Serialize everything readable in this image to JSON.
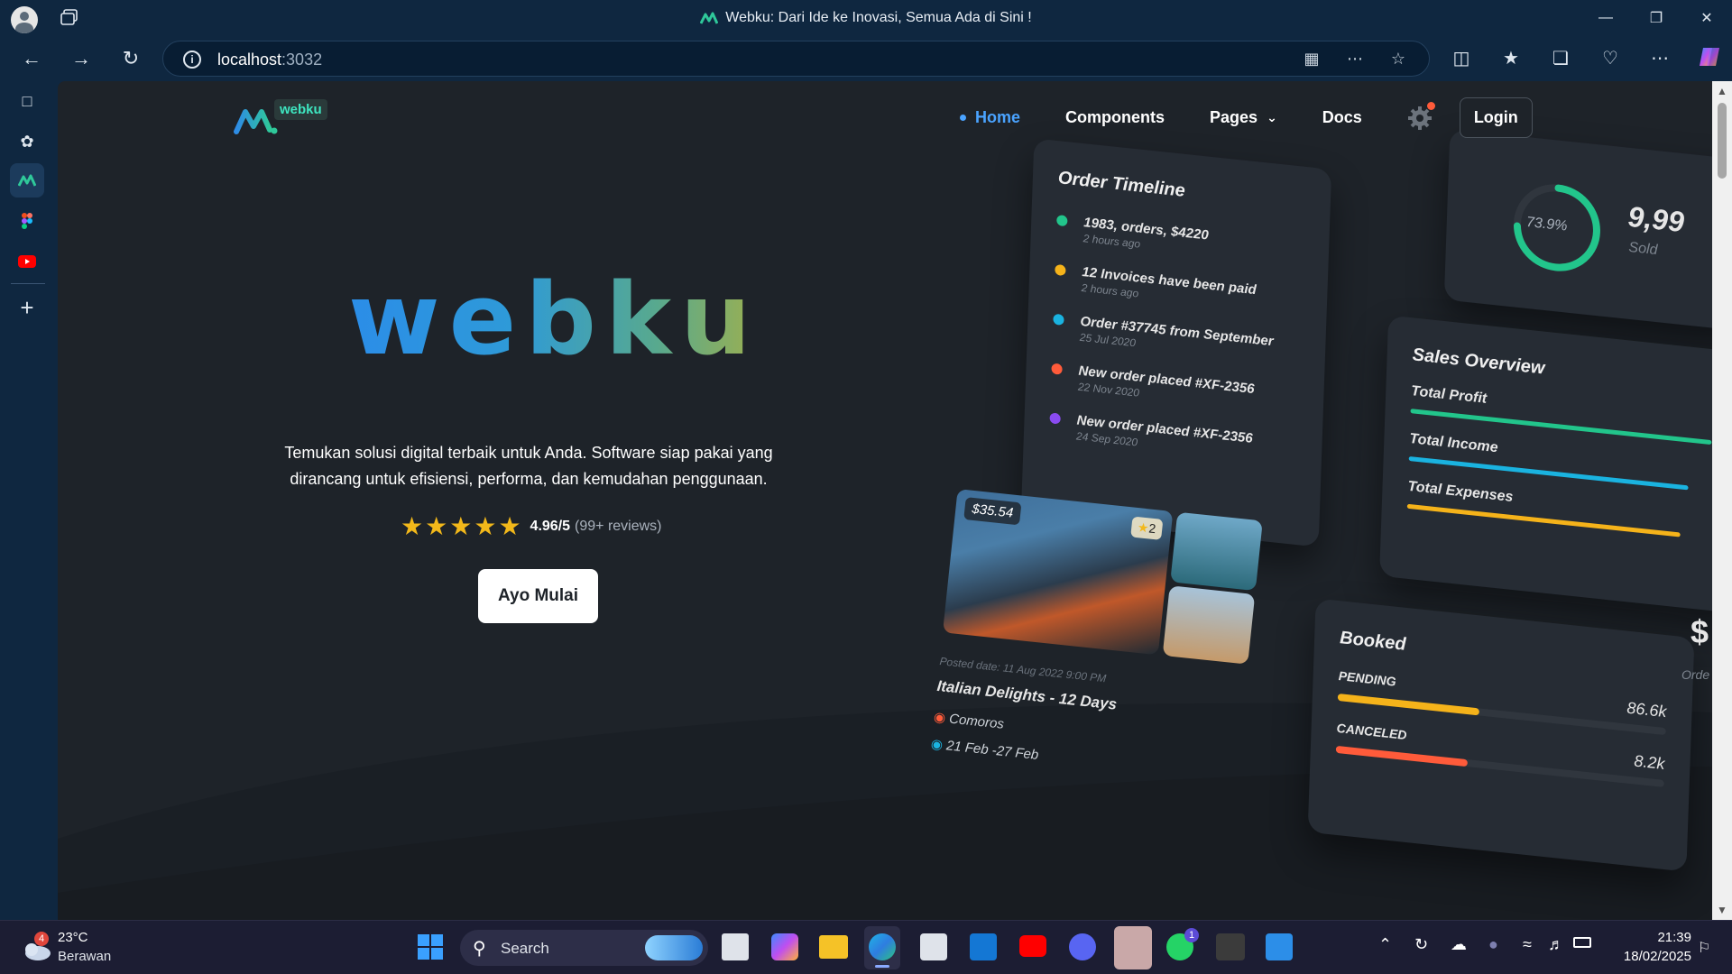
{
  "browser": {
    "tab_title": "Webku: Dari Ide ke Inovasi, Semua Ada di Sini !",
    "url_host": "localhost",
    "url_port": ":3032"
  },
  "site": {
    "logo_text": "webku",
    "nav": {
      "home": "Home",
      "components": "Components",
      "pages": "Pages",
      "docs": "Docs",
      "login": "Login"
    },
    "hero": {
      "title": "webku",
      "subtitle": "Temukan solusi digital terbaik untuk Anda. Software siap pakai yang dirancang untuk efisiensi, performa, dan kemudahan penggunaan.",
      "rating_score": "4.96/5",
      "rating_reviews": "(99+ reviews)",
      "stars": 5,
      "cta": "Ayo Mulai"
    },
    "collage": {
      "timeline_title": "Order Timeline",
      "timeline": [
        {
          "text": "1983, orders, $4220",
          "sub": "2 hours ago",
          "color": "#22c58b"
        },
        {
          "text": "12 Invoices have been paid",
          "sub": "2 hours ago",
          "color": "#f5b31a"
        },
        {
          "text": "Order #37745 from September",
          "sub": "25 Jul 2020",
          "color": "#1ab3e0"
        },
        {
          "text": "New order placed #XF-2356",
          "sub": "22 Nov 2020",
          "color": "#ff5b3a"
        },
        {
          "text": "New order placed #XF-2356",
          "sub": "24 Sep 2020",
          "color": "#8a4bf0"
        }
      ],
      "gauge_value": "73.9%",
      "gauge_fraction": 0.739,
      "sold_value": "9,99",
      "sold_label": "Sold",
      "sales_title": "Sales Overview",
      "sales": [
        {
          "label": "Total Profit",
          "color": "#22c58b",
          "fraction": 0.97
        },
        {
          "label": "Total Income",
          "color": "#1ab3e0",
          "fraction": 0.9
        },
        {
          "label": "Total Expenses",
          "color": "#f5b31a",
          "fraction": 0.88
        }
      ],
      "tour_price": "$35.54",
      "tour_rating": "2",
      "tour_date": "Posted date: 11 Aug 2022 9:00 PM",
      "tour_title": "Italian Delights - 12 Days",
      "tour_location": "Comoros",
      "tour_range": "21 Feb -27 Feb",
      "booked_title": "Booked",
      "booked": [
        {
          "label": "PENDING",
          "value": "86.6k",
          "color": "#f5b31a",
          "fraction": 0.43
        },
        {
          "label": "CANCELED",
          "value": "8.2k",
          "color": "#ff5b3a",
          "fraction": 0.4
        }
      ],
      "partial_dollar": "$",
      "partial_order": "Orde"
    }
  },
  "taskbar": {
    "weather_temp": "23°C",
    "weather_desc": "Berawan",
    "weather_badge": "4",
    "search_placeholder": "Search",
    "time": "21:39",
    "date": "18/02/2025",
    "whatsapp_badge": "1"
  }
}
